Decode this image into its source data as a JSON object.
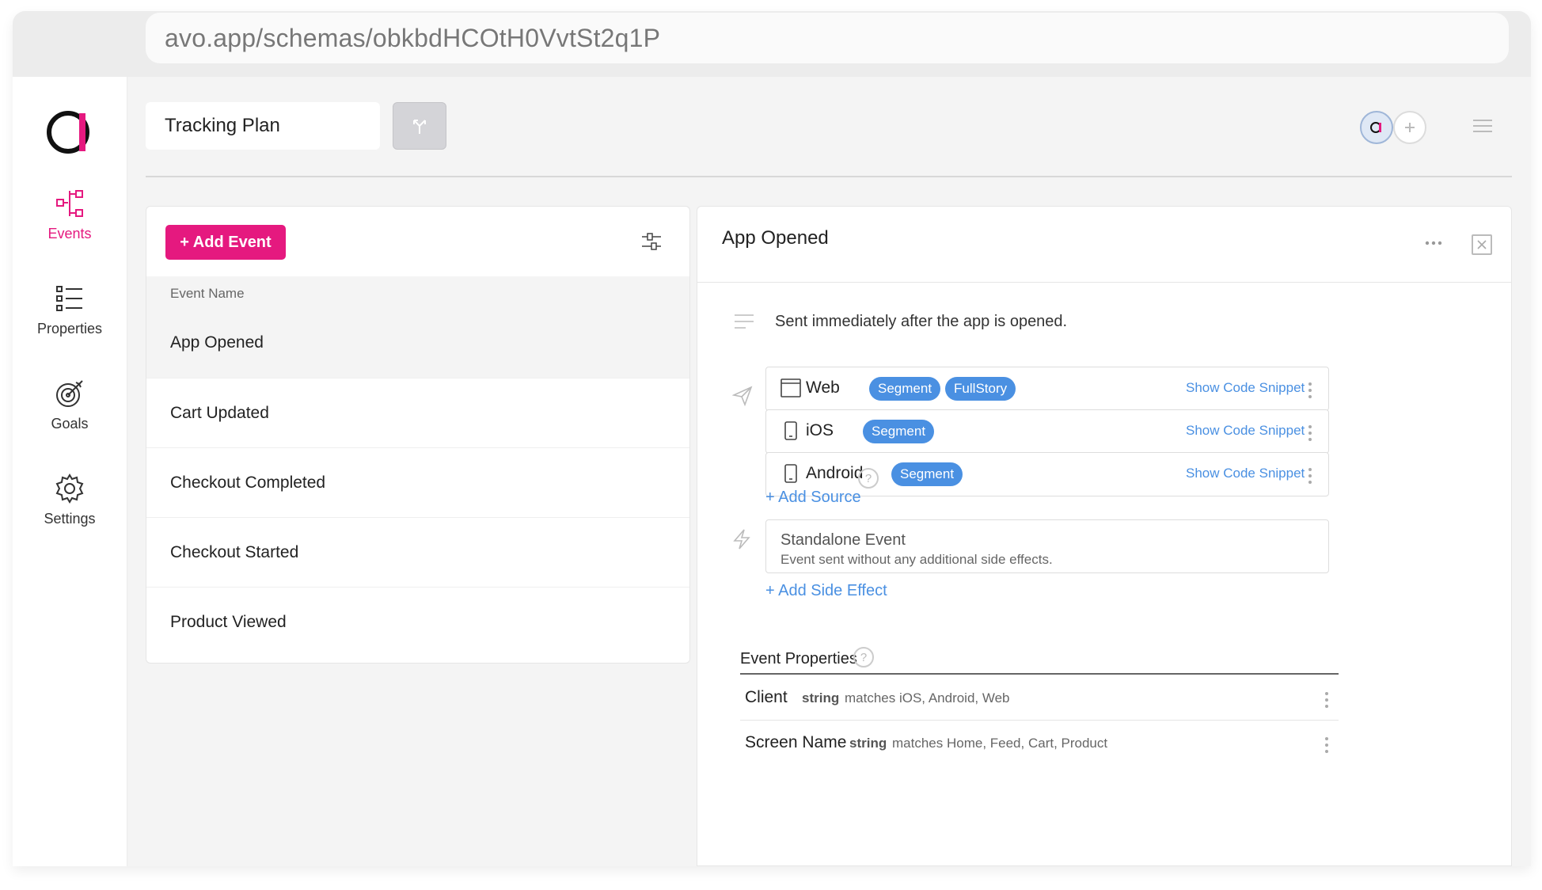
{
  "browser": {
    "url": "avo.app/schemas/obkbdHCOtH0VvtSt2q1P"
  },
  "sidebar": {
    "items": [
      {
        "label": "Events",
        "icon": "events-icon",
        "active": true
      },
      {
        "label": "Properties",
        "icon": "properties-icon",
        "active": false
      },
      {
        "label": "Goals",
        "icon": "goals-icon",
        "active": false
      },
      {
        "label": "Settings",
        "icon": "gear-icon",
        "active": false
      }
    ]
  },
  "header": {
    "plan_name": "Tracking Plan"
  },
  "events_panel": {
    "add_button": "+ Add Event",
    "column_header": "Event Name",
    "events": [
      "App Opened",
      "Cart Updated",
      "Checkout Completed",
      "Checkout Started",
      "Product Viewed"
    ],
    "selected": "App Opened"
  },
  "detail": {
    "title": "App Opened",
    "description": "Sent immediately after the app is opened.",
    "sources": [
      {
        "name": "Web",
        "icon": "browser-window-icon",
        "destinations": [
          "Segment",
          "FullStory"
        ],
        "snippet_label": "Show Code Snippet"
      },
      {
        "name": "iOS",
        "icon": "phone-icon",
        "destinations": [
          "Segment"
        ],
        "snippet_label": "Show Code Snippet"
      },
      {
        "name": "Android",
        "icon": "phone-icon",
        "destinations": [
          "Segment"
        ],
        "snippet_label": "Show Code Snippet"
      }
    ],
    "add_source": "+ Add Source",
    "help_glyph": "?",
    "side_effect": {
      "title": "Standalone Event",
      "description": "Event sent without any additional side effects."
    },
    "add_side_effect": "+ Add Side Effect",
    "properties_title": "Event Properties",
    "properties": [
      {
        "name": "Client",
        "type": "string",
        "match": "matches iOS, Android, Web"
      },
      {
        "name": "Screen Name",
        "type": "string",
        "match": "matches Home, Feed, Cart, Product"
      }
    ]
  },
  "colors": {
    "brand_pink": "#e5197f",
    "link_blue": "#4a90e2",
    "badge_blue": "#4a90e2"
  }
}
